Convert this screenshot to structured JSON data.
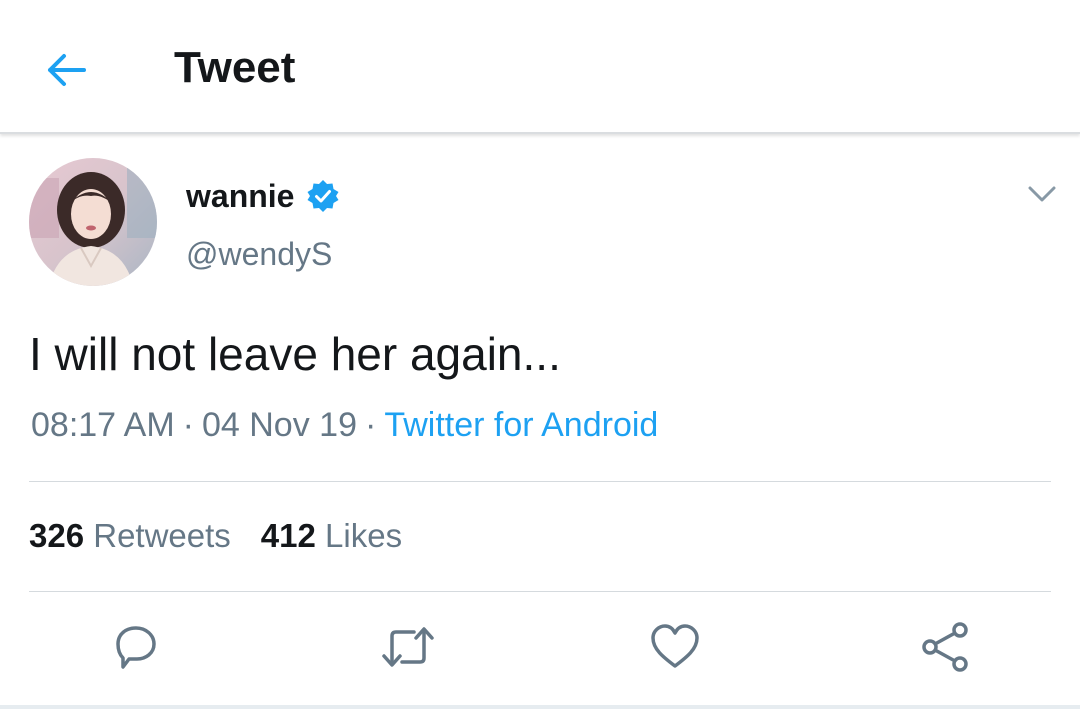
{
  "header": {
    "title": "Tweet",
    "back_icon": "arrow-left-icon"
  },
  "tweet": {
    "display_name": "wannie",
    "verified": true,
    "handle": "@wendyS",
    "text": "I will not leave her again...",
    "time": "08:17 AM",
    "date": "04 Nov 19",
    "source": "Twitter for Android",
    "separator": "·"
  },
  "stats": {
    "retweets_count": "326",
    "retweets_label": "Retweets",
    "likes_count": "412",
    "likes_label": "Likes"
  },
  "actions": [
    "reply-icon",
    "retweet-icon",
    "like-icon",
    "share-icon"
  ],
  "colors": {
    "accent": "#1da1f2",
    "text_primary": "#14171a",
    "text_secondary": "#657786",
    "divider": "#d5dade",
    "icon": "#657786"
  }
}
